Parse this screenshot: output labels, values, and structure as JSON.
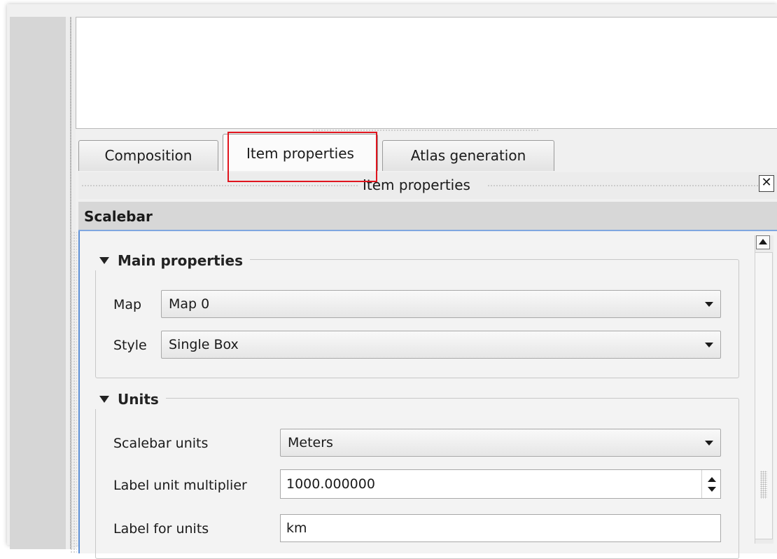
{
  "tabs": [
    {
      "label": "Composition"
    },
    {
      "label": "Item properties",
      "active": true
    },
    {
      "label": "Atlas generation"
    }
  ],
  "dock": {
    "title": "Item properties",
    "close_icon": "close-icon",
    "close_glyph": "✕"
  },
  "section": {
    "title": "Scalebar"
  },
  "main_group": {
    "title": "Main properties",
    "map": {
      "label": "Map",
      "value": "Map 0"
    },
    "style": {
      "label": "Style",
      "value": "Single Box"
    }
  },
  "units_group": {
    "title": "Units",
    "scalebar_units": {
      "label": "Scalebar units",
      "value": "Meters"
    },
    "label_multiplier": {
      "label": "Label unit multiplier",
      "value": "1000.000000"
    },
    "label_for_units": {
      "label": "Label for units",
      "value": "km"
    }
  },
  "colors": {
    "highlight": "#e0151e",
    "panel_accent": "#5b8fd6",
    "header_underline": "#7fa7e0"
  }
}
